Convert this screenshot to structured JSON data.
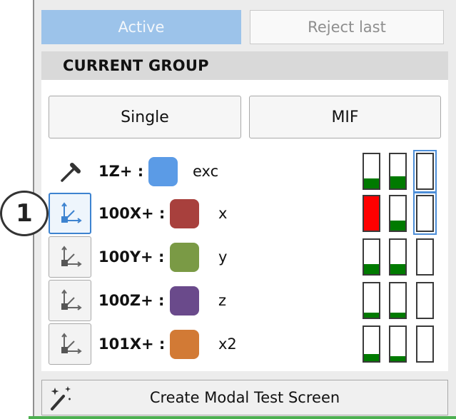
{
  "top_buttons": {
    "active_label": "Active",
    "reject_label": "Reject last"
  },
  "group": {
    "header": "CURRENT GROUP",
    "single_label": "Single",
    "mif_label": "MIF"
  },
  "rows": [
    {
      "label": "1Z+ :",
      "color": "#5b9be6",
      "name": "exc",
      "icon": "hammer-icon",
      "meters": [
        0.3,
        0.35,
        0.0
      ],
      "meter_colors": [
        "#007a00",
        "#007a00",
        "#007a00"
      ]
    },
    {
      "label": "100X+ :",
      "color": "#a8403d",
      "name": "x",
      "icon": "sensor-axes-icon",
      "meters": [
        1.0,
        0.3,
        0.0
      ],
      "meter_colors": [
        "#ff0000",
        "#007a00",
        "#007a00"
      ]
    },
    {
      "label": "100Y+ :",
      "color": "#7a9a45",
      "name": "y",
      "icon": "sensor-axes-icon",
      "meters": [
        0.3,
        0.3,
        0.0
      ],
      "meter_colors": [
        "#007a00",
        "#007a00",
        "#007a00"
      ]
    },
    {
      "label": "100Z+ :",
      "color": "#6a4a8b",
      "name": "z",
      "icon": "sensor-axes-icon",
      "meters": [
        0.15,
        0.15,
        0.0
      ],
      "meter_colors": [
        "#007a00",
        "#007a00",
        "#007a00"
      ]
    },
    {
      "label": "101X+ :",
      "color": "#d27a35",
      "name": "x2",
      "icon": "sensor-axes-icon",
      "meters": [
        0.2,
        0.15,
        0.0
      ],
      "meter_colors": [
        "#007a00",
        "#007a00",
        "#007a00"
      ]
    }
  ],
  "create_button": {
    "label": "Create Modal Test Screen",
    "icon": "magic-wand-icon"
  },
  "callout": {
    "number": "1"
  },
  "colors": {
    "accent": "#3d83d0",
    "active_button": "#9cc3ea"
  }
}
